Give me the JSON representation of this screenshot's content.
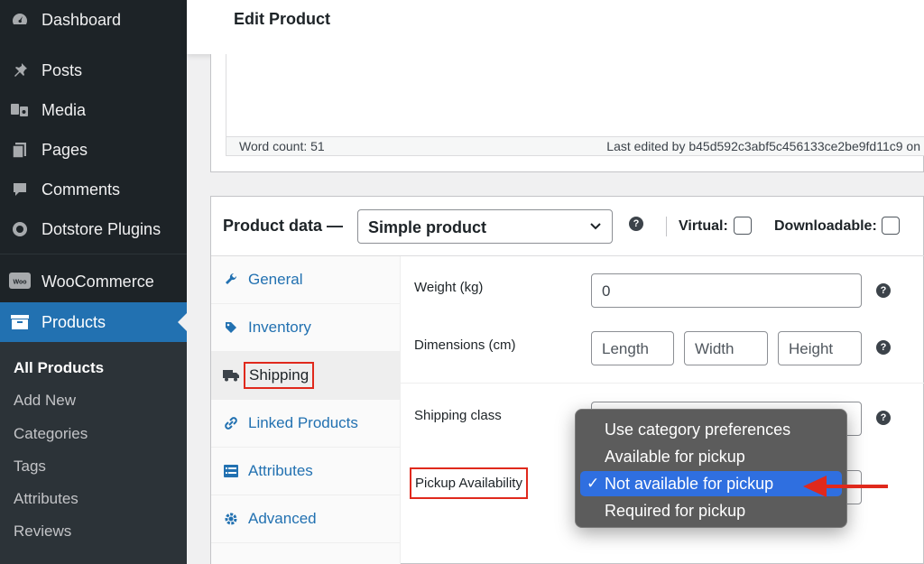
{
  "sidebar": {
    "menu": [
      {
        "label": "Dashboard",
        "icon": "dashboard-icon"
      },
      {
        "label": "Posts",
        "icon": "pin-icon"
      },
      {
        "label": "Media",
        "icon": "media-icon"
      },
      {
        "label": "Pages",
        "icon": "pages-icon"
      },
      {
        "label": "Comments",
        "icon": "comment-icon"
      },
      {
        "label": "Dotstore Plugins",
        "icon": "plugin-icon"
      },
      {
        "label": "WooCommerce",
        "icon": "woocommerce-icon"
      },
      {
        "label": "Products",
        "icon": "archive-icon"
      }
    ],
    "woo_logo_text": "Woo",
    "submenu": [
      "All Products",
      "Add New",
      "Categories",
      "Tags",
      "Attributes",
      "Reviews"
    ]
  },
  "header": {
    "title": "Edit Product"
  },
  "editor": {
    "word_count": "Word count: 51",
    "last_edited": "Last edited by b45d592c3abf5c456133ce2be9fd11c9 on"
  },
  "product_data": {
    "title": "Product data —",
    "type_value": "Simple product",
    "virtual_label": "Virtual:",
    "downloadable_label": "Downloadable:",
    "help_glyph": "?"
  },
  "tabs": [
    {
      "label": "General",
      "icon": "wrench-icon"
    },
    {
      "label": "Inventory",
      "icon": "tag-icon"
    },
    {
      "label": "Shipping",
      "icon": "truck-icon"
    },
    {
      "label": "Linked Products",
      "icon": "link-icon"
    },
    {
      "label": "Attributes",
      "icon": "list-icon"
    },
    {
      "label": "Advanced",
      "icon": "gear-icon"
    }
  ],
  "shipping": {
    "weight_label": "Weight (kg)",
    "weight_value": "0",
    "dimensions_label": "Dimensions (cm)",
    "length_placeholder": "Length",
    "width_placeholder": "Width",
    "height_placeholder": "Height",
    "shipping_class_label": "Shipping class",
    "pickup_label": "Pickup Availability"
  },
  "pickup_dropdown": {
    "options": [
      "Use category preferences",
      "Available for pickup",
      "Not available for pickup",
      "Required for pickup"
    ],
    "selected": "Not available for pickup",
    "check_glyph": "✓"
  },
  "colors": {
    "sidebar_bg": "#1d2327",
    "accent": "#2271b1",
    "highlight_red": "#e0291c",
    "selected_option": "#2f6fe0"
  }
}
